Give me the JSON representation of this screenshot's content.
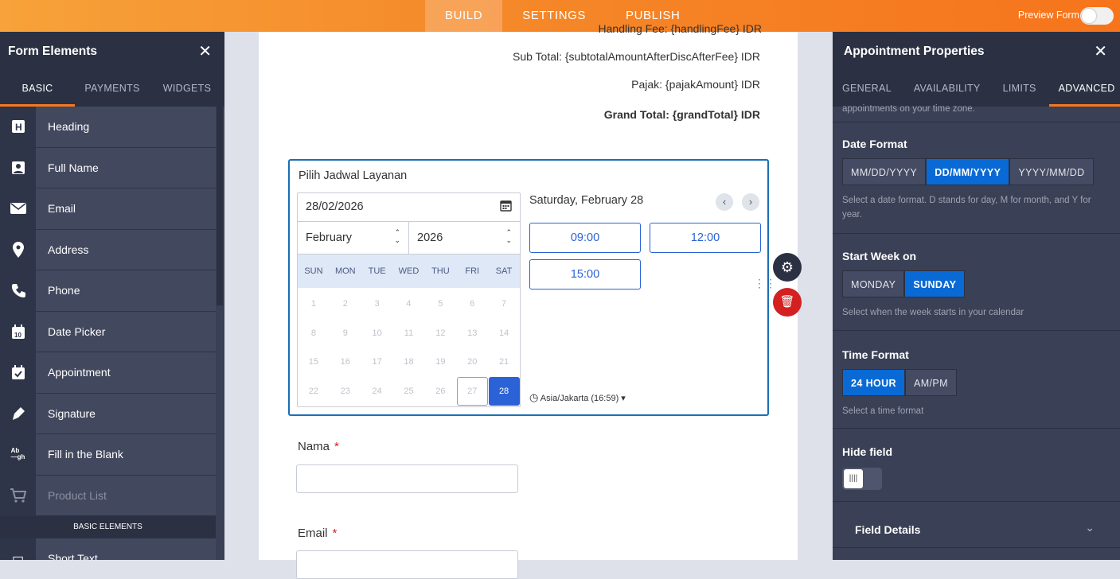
{
  "topbar": {
    "tabs": [
      "BUILD",
      "SETTINGS",
      "PUBLISH"
    ],
    "preview": "Preview Form"
  },
  "left": {
    "title": "Form Elements",
    "tabs": [
      "BASIC",
      "PAYMENTS",
      "WIDGETS"
    ],
    "items": [
      {
        "label": "Heading",
        "icon": "heading-icon"
      },
      {
        "label": "Full Name",
        "icon": "person-icon"
      },
      {
        "label": "Email",
        "icon": "envelope-icon"
      },
      {
        "label": "Address",
        "icon": "location-pin-icon"
      },
      {
        "label": "Phone",
        "icon": "phone-icon"
      },
      {
        "label": "Date Picker",
        "icon": "calendar-icon"
      },
      {
        "label": "Appointment",
        "icon": "calendar-check-icon"
      },
      {
        "label": "Signature",
        "icon": "pen-icon"
      },
      {
        "label": "Fill in the Blank",
        "icon": "fill-blank-icon"
      },
      {
        "label": "Product List",
        "icon": "cart-icon"
      }
    ],
    "section": "BASIC ELEMENTS",
    "short_text": "Short Text"
  },
  "form": {
    "partial_line": "Handling Fee: {handlingFee} IDR",
    "subtotal": "Sub Total: {subtotalAmountAfterDiscAfterFee} IDR",
    "pajak": "Pajak: {pajakAmount} IDR",
    "grand": "Grand Total: {grandTotal} IDR",
    "widget_title": "Pilih Jadwal Layanan",
    "date_value": "28/02/2026",
    "month": "February",
    "year": "2026",
    "weekdays": [
      "SUN",
      "MON",
      "TUE",
      "WED",
      "THU",
      "FRI",
      "SAT"
    ],
    "days": [
      "1",
      "2",
      "3",
      "4",
      "5",
      "6",
      "7",
      "8",
      "9",
      "10",
      "11",
      "12",
      "13",
      "14",
      "15",
      "16",
      "17",
      "18",
      "19",
      "20",
      "21",
      "22",
      "23",
      "24",
      "25",
      "26",
      "27",
      "28"
    ],
    "selected_day": "Saturday, February 28",
    "slots": [
      "09:00",
      "12:00",
      "15:00"
    ],
    "timezone": "Asia/Jakarta (16:59)",
    "nama_label": "Nama",
    "email_label": "Email",
    "required": "*"
  },
  "right": {
    "title": "Appointment Properties",
    "tabs": [
      "GENERAL",
      "AVAILABILITY",
      "LIMITS",
      "ADVANCED"
    ],
    "tz_note": "appointments on your time zone.",
    "date_format": {
      "title": "Date Format",
      "options": [
        "MM/DD/YYYY",
        "DD/MM/YYYY",
        "YYYY/MM/DD"
      ],
      "selected": "DD/MM/YYYY",
      "help": "Select a date format. D stands for day, M for month, and Y for year."
    },
    "start_week": {
      "title": "Start Week on",
      "options": [
        "MONDAY",
        "SUNDAY"
      ],
      "selected": "SUNDAY",
      "help": "Select when the week starts in your calendar"
    },
    "time_format": {
      "title": "Time Format",
      "options": [
        "24 HOUR",
        "AM/PM"
      ],
      "selected": "24 HOUR",
      "help": "Select a time format"
    },
    "hide_field": {
      "title": "Hide field",
      "on": false
    },
    "field_details": "Field Details"
  }
}
